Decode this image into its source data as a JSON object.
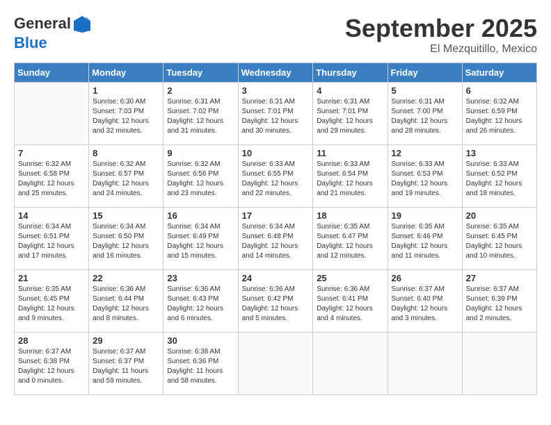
{
  "header": {
    "logo_general": "General",
    "logo_blue": "Blue",
    "month": "September 2025",
    "location": "El Mezquitillo, Mexico"
  },
  "days_of_week": [
    "Sunday",
    "Monday",
    "Tuesday",
    "Wednesday",
    "Thursday",
    "Friday",
    "Saturday"
  ],
  "weeks": [
    [
      {
        "num": "",
        "info": ""
      },
      {
        "num": "1",
        "info": "Sunrise: 6:30 AM\nSunset: 7:03 PM\nDaylight: 12 hours\nand 32 minutes."
      },
      {
        "num": "2",
        "info": "Sunrise: 6:31 AM\nSunset: 7:02 PM\nDaylight: 12 hours\nand 31 minutes."
      },
      {
        "num": "3",
        "info": "Sunrise: 6:31 AM\nSunset: 7:01 PM\nDaylight: 12 hours\nand 30 minutes."
      },
      {
        "num": "4",
        "info": "Sunrise: 6:31 AM\nSunset: 7:01 PM\nDaylight: 12 hours\nand 29 minutes."
      },
      {
        "num": "5",
        "info": "Sunrise: 6:31 AM\nSunset: 7:00 PM\nDaylight: 12 hours\nand 28 minutes."
      },
      {
        "num": "6",
        "info": "Sunrise: 6:32 AM\nSunset: 6:59 PM\nDaylight: 12 hours\nand 26 minutes."
      }
    ],
    [
      {
        "num": "7",
        "info": "Sunrise: 6:32 AM\nSunset: 6:58 PM\nDaylight: 12 hours\nand 25 minutes."
      },
      {
        "num": "8",
        "info": "Sunrise: 6:32 AM\nSunset: 6:57 PM\nDaylight: 12 hours\nand 24 minutes."
      },
      {
        "num": "9",
        "info": "Sunrise: 6:32 AM\nSunset: 6:56 PM\nDaylight: 12 hours\nand 23 minutes."
      },
      {
        "num": "10",
        "info": "Sunrise: 6:33 AM\nSunset: 6:55 PM\nDaylight: 12 hours\nand 22 minutes."
      },
      {
        "num": "11",
        "info": "Sunrise: 6:33 AM\nSunset: 6:54 PM\nDaylight: 12 hours\nand 21 minutes."
      },
      {
        "num": "12",
        "info": "Sunrise: 6:33 AM\nSunset: 6:53 PM\nDaylight: 12 hours\nand 19 minutes."
      },
      {
        "num": "13",
        "info": "Sunrise: 6:33 AM\nSunset: 6:52 PM\nDaylight: 12 hours\nand 18 minutes."
      }
    ],
    [
      {
        "num": "14",
        "info": "Sunrise: 6:34 AM\nSunset: 6:51 PM\nDaylight: 12 hours\nand 17 minutes."
      },
      {
        "num": "15",
        "info": "Sunrise: 6:34 AM\nSunset: 6:50 PM\nDaylight: 12 hours\nand 16 minutes."
      },
      {
        "num": "16",
        "info": "Sunrise: 6:34 AM\nSunset: 6:49 PM\nDaylight: 12 hours\nand 15 minutes."
      },
      {
        "num": "17",
        "info": "Sunrise: 6:34 AM\nSunset: 6:48 PM\nDaylight: 12 hours\nand 14 minutes."
      },
      {
        "num": "18",
        "info": "Sunrise: 6:35 AM\nSunset: 6:47 PM\nDaylight: 12 hours\nand 12 minutes."
      },
      {
        "num": "19",
        "info": "Sunrise: 6:35 AM\nSunset: 6:46 PM\nDaylight: 12 hours\nand 11 minutes."
      },
      {
        "num": "20",
        "info": "Sunrise: 6:35 AM\nSunset: 6:45 PM\nDaylight: 12 hours\nand 10 minutes."
      }
    ],
    [
      {
        "num": "21",
        "info": "Sunrise: 6:35 AM\nSunset: 6:45 PM\nDaylight: 12 hours\nand 9 minutes."
      },
      {
        "num": "22",
        "info": "Sunrise: 6:36 AM\nSunset: 6:44 PM\nDaylight: 12 hours\nand 8 minutes."
      },
      {
        "num": "23",
        "info": "Sunrise: 6:36 AM\nSunset: 6:43 PM\nDaylight: 12 hours\nand 6 minutes."
      },
      {
        "num": "24",
        "info": "Sunrise: 6:36 AM\nSunset: 6:42 PM\nDaylight: 12 hours\nand 5 minutes."
      },
      {
        "num": "25",
        "info": "Sunrise: 6:36 AM\nSunset: 6:41 PM\nDaylight: 12 hours\nand 4 minutes."
      },
      {
        "num": "26",
        "info": "Sunrise: 6:37 AM\nSunset: 6:40 PM\nDaylight: 12 hours\nand 3 minutes."
      },
      {
        "num": "27",
        "info": "Sunrise: 6:37 AM\nSunset: 6:39 PM\nDaylight: 12 hours\nand 2 minutes."
      }
    ],
    [
      {
        "num": "28",
        "info": "Sunrise: 6:37 AM\nSunset: 6:38 PM\nDaylight: 12 hours\nand 0 minutes."
      },
      {
        "num": "29",
        "info": "Sunrise: 6:37 AM\nSunset: 6:37 PM\nDaylight: 11 hours\nand 59 minutes."
      },
      {
        "num": "30",
        "info": "Sunrise: 6:38 AM\nSunset: 6:36 PM\nDaylight: 11 hours\nand 58 minutes."
      },
      {
        "num": "",
        "info": ""
      },
      {
        "num": "",
        "info": ""
      },
      {
        "num": "",
        "info": ""
      },
      {
        "num": "",
        "info": ""
      }
    ]
  ]
}
